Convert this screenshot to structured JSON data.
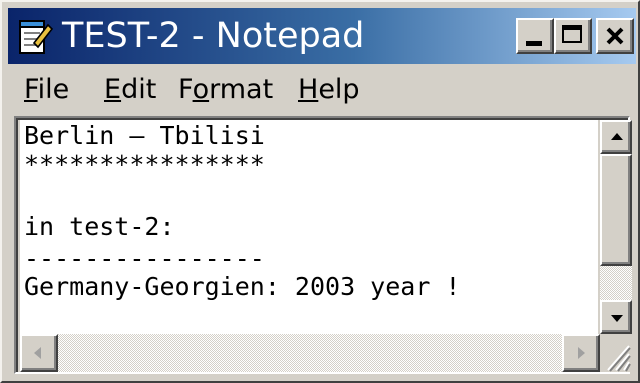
{
  "window": {
    "title": "TEST-2 - Notepad",
    "icon": "notepad-icon",
    "accent_color": "#0a246a",
    "controls": [
      "minimize-icon",
      "maximize-icon",
      "close-icon"
    ]
  },
  "menu": {
    "file": {
      "key": "F",
      "rest": "ile"
    },
    "edit": {
      "key": "E",
      "rest": "dit"
    },
    "format": {
      "pre": "F",
      "key": "o",
      "rest": "rmat"
    },
    "help": {
      "key": "H",
      "rest": "elp"
    }
  },
  "document": {
    "lines": [
      "Berlin – Tbilisi",
      "****************",
      "",
      "in test-2:",
      "----------------",
      "Germany-Georgien: 2003 year !"
    ]
  }
}
